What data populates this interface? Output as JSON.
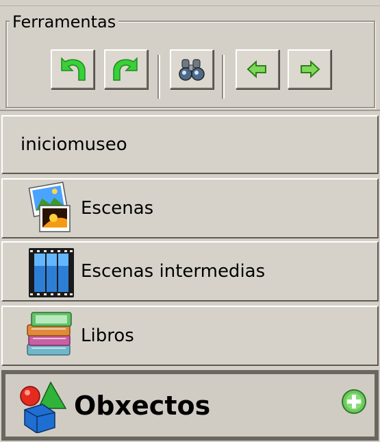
{
  "toolbar": {
    "title": "Ferramentas",
    "buttons": [
      {
        "name": "undo",
        "icon": "undo-arrow-icon"
      },
      {
        "name": "redo",
        "icon": "redo-arrow-icon"
      },
      {
        "name": "search",
        "icon": "binoculars-icon"
      },
      {
        "name": "back",
        "icon": "arrow-left-icon"
      },
      {
        "name": "forward",
        "icon": "arrow-right-icon"
      }
    ]
  },
  "tree": {
    "root": "iniciomuseo",
    "items": [
      {
        "label": "Escenas",
        "icon": "picture-icon"
      },
      {
        "label": "Escenas intermedias",
        "icon": "film-strip-icon"
      },
      {
        "label": "Libros",
        "icon": "books-icon"
      },
      {
        "label": "Obxectos",
        "icon": "shapes-icon",
        "selected": true,
        "action_icon": "add-circle-icon"
      }
    ]
  },
  "colors": {
    "accent_green": "#35c23a",
    "panel": "#d4d0c8"
  }
}
